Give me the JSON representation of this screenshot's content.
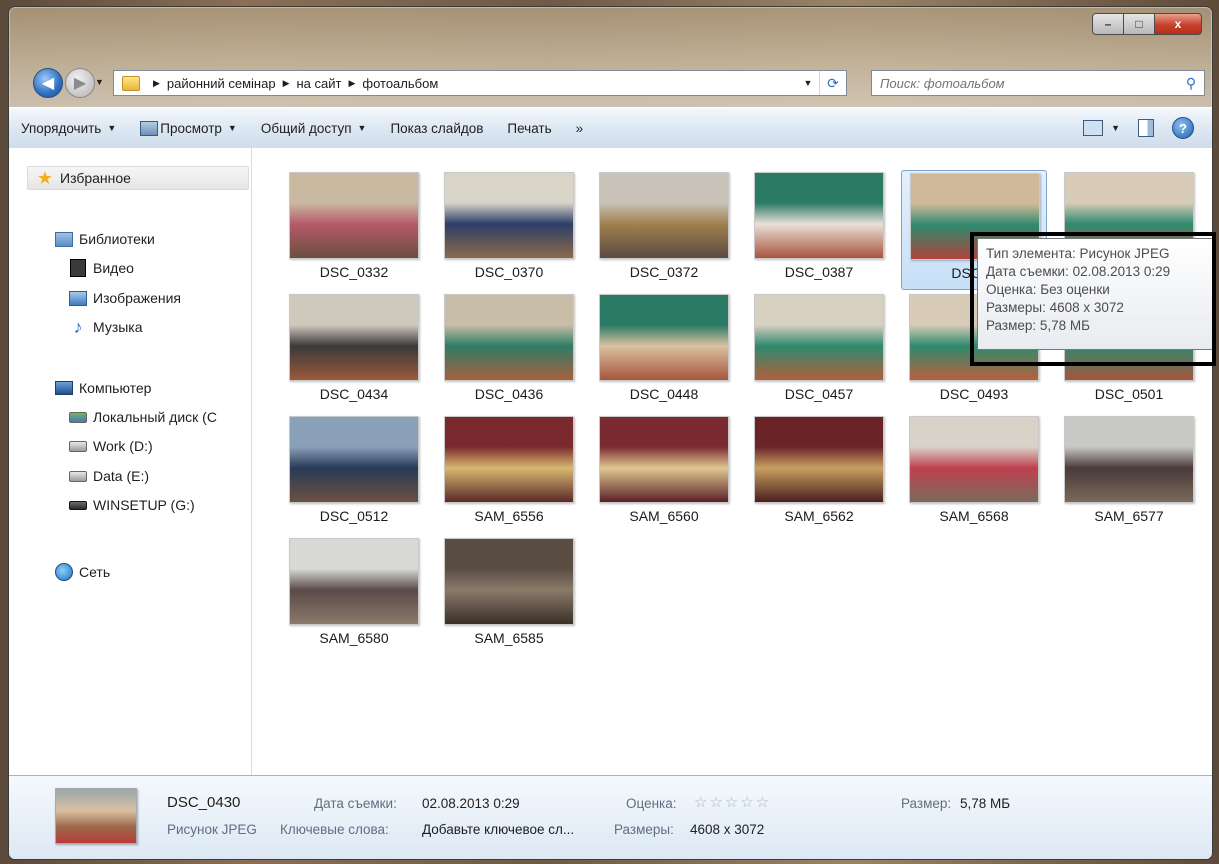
{
  "window": {
    "caption": {
      "minimize": "–",
      "maximize": "□",
      "close": "x"
    }
  },
  "address": {
    "crumbs": [
      "районний семінар",
      "на сайт",
      "фотоальбом"
    ],
    "search_placeholder": "Поиск: фотоальбом"
  },
  "toolbar": {
    "organize": "Упорядочить",
    "view": "Просмотр",
    "share": "Общий доступ",
    "slideshow": "Показ слайдов",
    "print": "Печать",
    "more": "»"
  },
  "nav": {
    "favorites": "Избранное",
    "libraries": "Библиотеки",
    "video": "Видео",
    "images": "Изображения",
    "music": "Музыка",
    "computer": "Компьютер",
    "local_disk": "Локальный диск (C",
    "work": "Work (D:)",
    "data": "Data (E:)",
    "winsetup": "WINSETUP (G:)",
    "network": "Сеть"
  },
  "files": [
    {
      "name": "DSC_0332",
      "colors": [
        "#c9b9a0",
        "#b65a6a",
        "#6b4e3e"
      ]
    },
    {
      "name": "DSC_0370",
      "colors": [
        "#d8d4c8",
        "#2c3e6a",
        "#8c6a4a"
      ]
    },
    {
      "name": "DSC_0372",
      "colors": [
        "#c8c2b8",
        "#a0804e",
        "#5a4a40"
      ]
    },
    {
      "name": "DSC_0387",
      "colors": [
        "#2a7a64",
        "#e8e0d8",
        "#a8553e"
      ]
    },
    {
      "name": "DSC_0",
      "colors": [
        "#d0b89a",
        "#2e8a6e",
        "#b0433a"
      ]
    },
    {
      "name": "",
      "colors": [
        "#d8ccb8",
        "#2e8a6e",
        "#b85a3e"
      ]
    },
    {
      "name": "DSC_0434",
      "colors": [
        "#cfc8bc",
        "#3a3a3a",
        "#9a5a3a"
      ]
    },
    {
      "name": "DSC_0436",
      "colors": [
        "#c8bea8",
        "#2e7c66",
        "#a8603e"
      ]
    },
    {
      "name": "DSC_0448",
      "colors": [
        "#2a7a64",
        "#d8c2a0",
        "#a8553e"
      ]
    },
    {
      "name": "DSC_0457",
      "colors": [
        "#d8d0c0",
        "#2e8a6e",
        "#b0603e"
      ]
    },
    {
      "name": "DSC_0493",
      "colors": [
        "#d8ccb8",
        "#2e8a6e",
        "#b8603e"
      ]
    },
    {
      "name": "DSC_0501",
      "colors": [
        "#cfc2ae",
        "#2e8a6e",
        "#a8553e"
      ]
    },
    {
      "name": "DSC_0512",
      "colors": [
        "#8aa0b8",
        "#2a3a5a",
        "#6a5040"
      ]
    },
    {
      "name": "SAM_6556",
      "colors": [
        "#7a2a2e",
        "#d8b870",
        "#5a2a28"
      ]
    },
    {
      "name": "SAM_6560",
      "colors": [
        "#7a2a30",
        "#e0c890",
        "#5a2028"
      ]
    },
    {
      "name": "SAM_6562",
      "colors": [
        "#6a2428",
        "#c8a060",
        "#4a1e20"
      ]
    },
    {
      "name": "SAM_6568",
      "colors": [
        "#d8d2c8",
        "#c04050",
        "#7a6a5a"
      ]
    },
    {
      "name": "SAM_6577",
      "colors": [
        "#c8c8c4",
        "#4a3a3a",
        "#7a6a5a"
      ]
    },
    {
      "name": "SAM_6580",
      "colors": [
        "#d8d8d4",
        "#5a4a48",
        "#8a7a6a"
      ]
    },
    {
      "name": "SAM_6585",
      "colors": [
        "#5a4e44",
        "#8a7a6a",
        "#3a3028"
      ]
    }
  ],
  "tooltip": {
    "type": "Тип элемента: Рисунок JPEG",
    "date": "Дата съемки: 02.08.2013 0:29",
    "rating": "Оценка: Без оценки",
    "dimensions": "Размеры: 4608 x 3072",
    "size": "Размер: 5,78 МБ"
  },
  "details": {
    "name": "DSC_0430",
    "type": "Рисунок JPEG",
    "date_label": "Дата съемки:",
    "date_value": "02.08.2013 0:29",
    "keywords_label": "Ключевые слова:",
    "keywords_value": "Добавьте ключевое сл...",
    "rating_label": "Оценка:",
    "rating_stars": "☆☆☆☆☆",
    "dimensions_label": "Размеры:",
    "dimensions_value": "4608 x 3072",
    "size_label": "Размер:",
    "size_value": "5,78 МБ"
  }
}
